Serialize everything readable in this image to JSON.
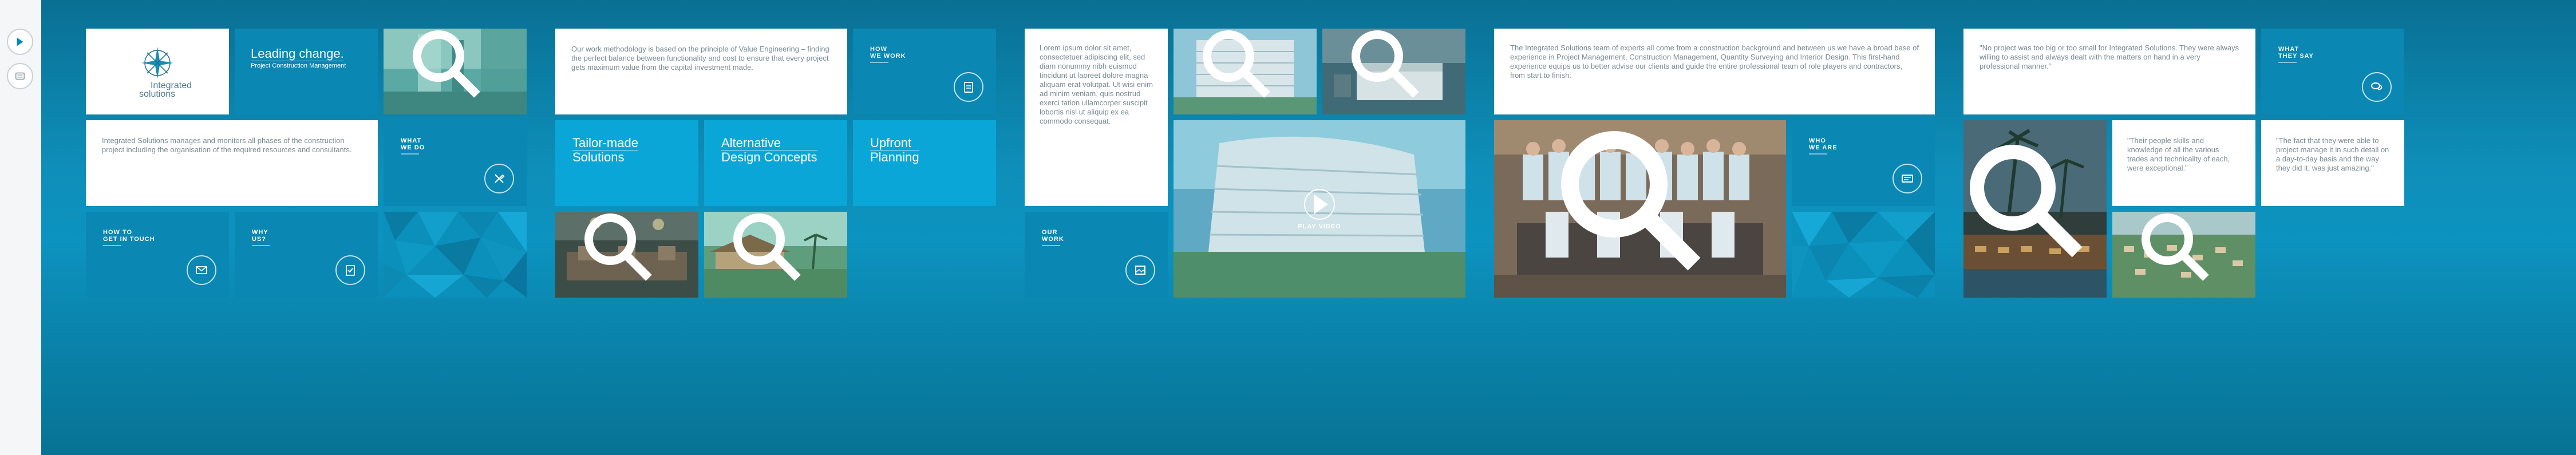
{
  "nav": {
    "next_icon": "chevron-right-icon",
    "menu_icon": "menu-icon"
  },
  "logo": {
    "name_line1": "Integrated",
    "name_line2": "solutions"
  },
  "hero": {
    "title": "Leading change.",
    "subtitle": "Project Construction Management"
  },
  "intro_text": "Integrated Solutions manages and monitors all phases of the construction project including the organisation of the required resources and consultants.",
  "what_we_do": {
    "label_line1": "WHAT",
    "label_line2": "WE DO"
  },
  "how_to_get_in_touch": {
    "label_line1": "HOW TO",
    "label_line2": "GET IN TOUCH"
  },
  "why_us": {
    "label_line1": "WHY",
    "label_line2": "US?"
  },
  "methodology_text": "Our work methodology is based on the principle of Value Engineering – finding the perfect balance between functionality and cost to ensure that every project gets maximum value from the capital investment made.",
  "how_we_work": {
    "label_line1": "HOW",
    "label_line2": "WE WORK"
  },
  "services": [
    {
      "line1": "Tailor-made",
      "line2": "Solutions"
    },
    {
      "line1": "Alternative",
      "line2": "Design Concepts"
    },
    {
      "line1": "Upfront",
      "line2": "Planning"
    }
  ],
  "lorem_text": "Lorem ipsum dolor sit amet, consectetuer adipiscing elit, sed diam nonummy nibh euismod tincidunt ut laoreet dolore magna aliquam erat volutpat. Ut wisi enim ad minim veniam, quis nostrud exerci tation ullamcorper suscipit lobortis nisl ut aliquip ex ea commodo consequat.",
  "our_work": {
    "label_line1": "OUR",
    "label_line2": "WORK"
  },
  "video": {
    "label": "PLAY VIDEO"
  },
  "team_text": "The Integrated Solutions team of experts all come from a construction background and between us we have a broad base of experience in Project Management, Construction Management, Quantity Surveying and Interior Design. This first-hand experience equips us to better advise our clients and guide the entire professional team of role players and contractors, from start to finish.",
  "who_we_are": {
    "label_line1": "WHO",
    "label_line2": "WE ARE"
  },
  "testimonial_main": "\"No project was too big or too small for Integrated Solutions. They were always willing to assist and always dealt with the matters on hand in a very professional manner.\"",
  "what_they_say": {
    "label_line1": "WHAT",
    "label_line2": "THEY SAY"
  },
  "testimonial_2": "\"Their people skills and knowledge of all the various trades and technicality of each, were exceptional.\"",
  "testimonial_3": "\"The fact that they were able to project manage it in such detail on a day-to-day basis and the way they did it, was just amazing.\"",
  "colors": {
    "tile_blue": "#0a87b2",
    "tile_light_blue": "#0ba6d8",
    "background_blue": "#0c93bf"
  }
}
